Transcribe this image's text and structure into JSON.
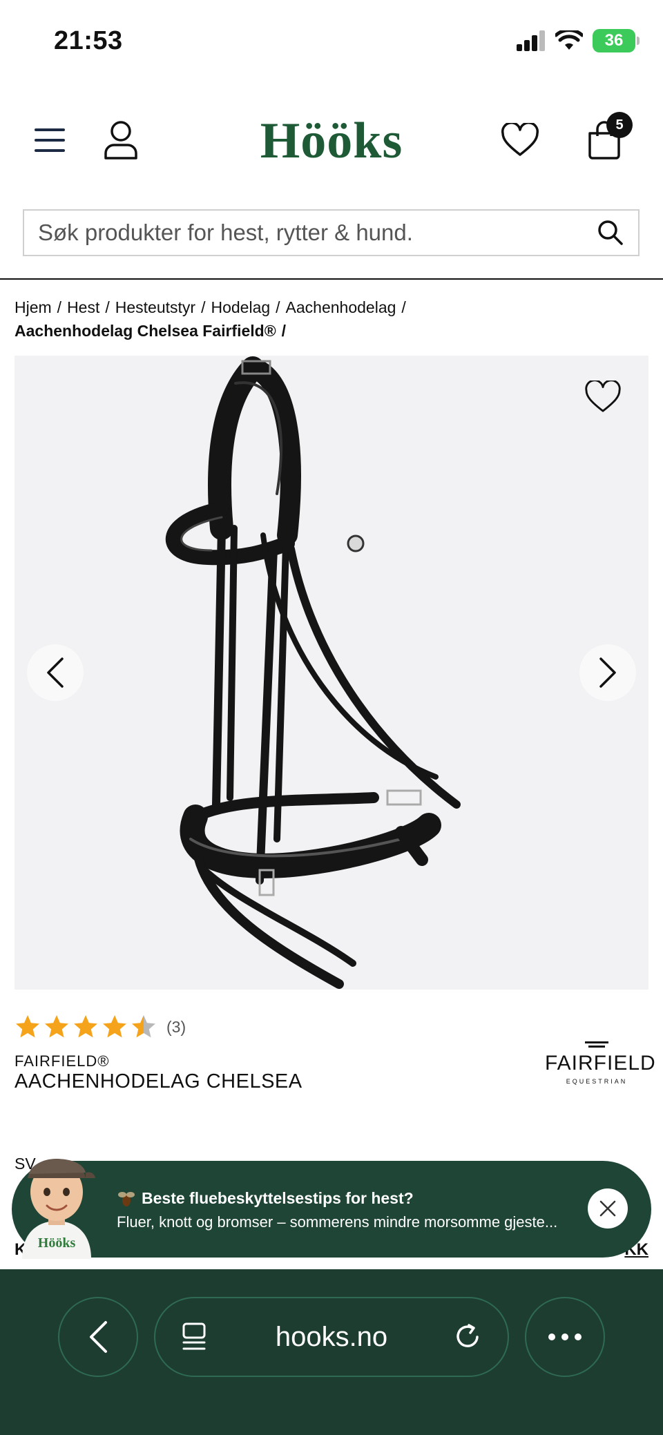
{
  "status": {
    "time": "21:53",
    "battery": "36"
  },
  "header": {
    "logo": "Hööks",
    "cart_count": "5"
  },
  "search": {
    "placeholder": "Søk produkter for hest, rytter & hund."
  },
  "breadcrumb": {
    "items": [
      "Hjem",
      "Hest",
      "Hesteutstyr",
      "Hodelag",
      "Aachenhodelag"
    ],
    "current": "Aachenhodelag Chelsea Fairfield®"
  },
  "product": {
    "rating_value": 4.5,
    "rating_max": 5,
    "rating_count": "(3)",
    "brand": "FAIRFIELD®",
    "title": "AACHENHODELAG CHELSEA",
    "brand_logo_main": "FAIRFIELD",
    "brand_logo_sub": "EQUESTRIAN",
    "partial_label": "SV",
    "partial_left": "KR",
    "partial_right": "KK"
  },
  "notification": {
    "title": "Beste fluebeskyttelsestips for hest?",
    "text": "Fluer, knott og bromser – sommerens mindre morsomme gjeste...",
    "avatar_cap_text": "Hööks"
  },
  "browser": {
    "url": "hooks.no"
  },
  "colors": {
    "brand_green": "#1f5a36",
    "notif_bg": "#1e4536",
    "browser_bg": "#1d3d30",
    "star": "#f5a31a"
  }
}
